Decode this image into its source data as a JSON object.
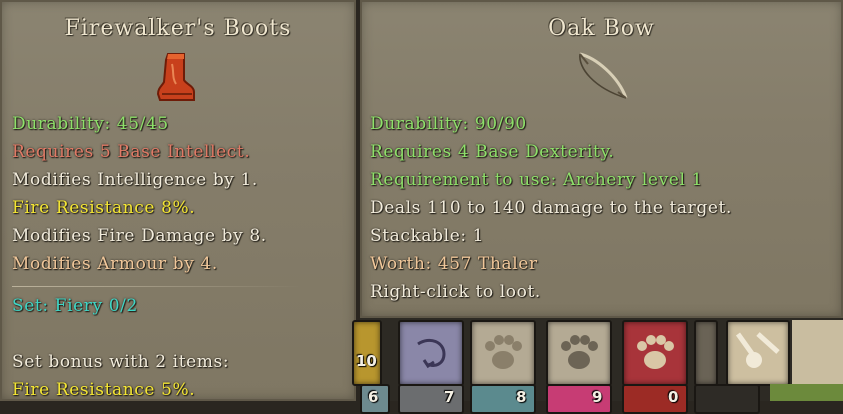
{
  "left_tooltip": {
    "title": "Firewalker's Boots",
    "icon": "boots-icon",
    "lines": [
      {
        "text": "Durability: 45/45",
        "color": "#8ee06a"
      },
      {
        "text": "Requires 5 Base Intellect.",
        "color": "#e07a66"
      },
      {
        "text": "Modifies Intelligence by 1.",
        "color": "#f2ecdc"
      },
      {
        "text": "Fire Resistance 8%.",
        "color": "#f4e634"
      },
      {
        "text": "Modifies Fire Damage by 8.",
        "color": "#f2ecdc"
      },
      {
        "text": "Modifies Armour by 4.",
        "color": "#f0c79a"
      }
    ],
    "set_label": "Set: Fiery 0/2",
    "set_label_color": "#3fd6c6",
    "set_bonus_header": "Set bonus with 2 items:",
    "set_bonus_line": "Fire Resistance 5%."
  },
  "right_tooltip": {
    "title": "Oak Bow",
    "icon": "bow-icon",
    "lines": [
      {
        "text": "Durability: 90/90",
        "color": "#8ee06a"
      },
      {
        "text": "Requires 4 Base Dexterity.",
        "color": "#8ee06a"
      },
      {
        "text": "Requirement to use: Archery level 1",
        "color": "#8ee06a"
      },
      {
        "text": "Deals 110 to 140 damage to the target.",
        "color": "#f2ecdc"
      },
      {
        "text": "Stackable: 1",
        "color": "#f2ecdc"
      },
      {
        "text": "Worth: 457 Thaler",
        "color": "#f0c79a"
      },
      {
        "text": "Right-click to loot.",
        "color": "#f2ecdc"
      }
    ]
  },
  "action_bar": {
    "top_row_counts": [
      "10"
    ],
    "bottom_row_counts": [
      "6",
      "7",
      "8",
      "9",
      "0"
    ]
  }
}
